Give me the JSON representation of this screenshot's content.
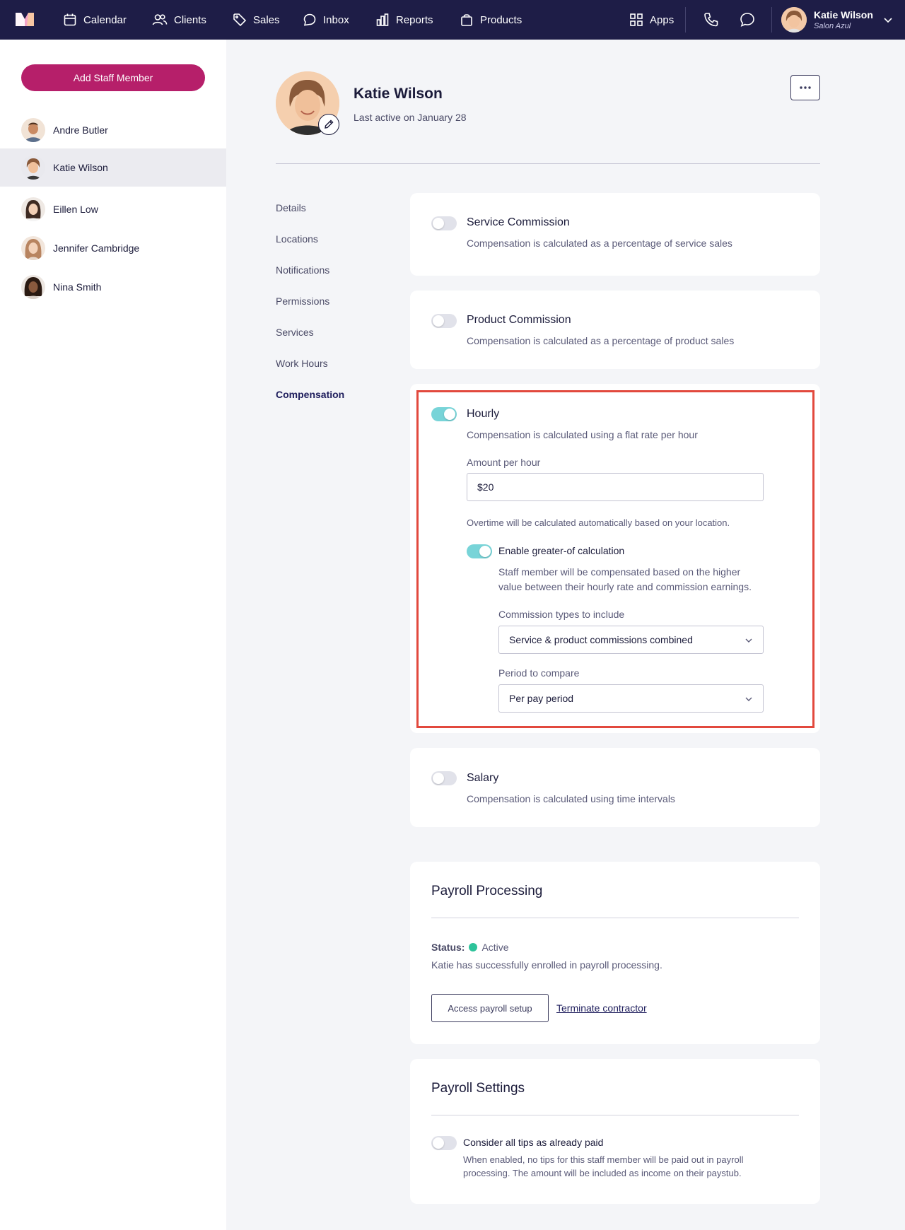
{
  "nav": {
    "items": [
      {
        "label": "Calendar",
        "icon": "calendar-icon"
      },
      {
        "label": "Clients",
        "icon": "clients-icon"
      },
      {
        "label": "Sales",
        "icon": "tag-icon"
      },
      {
        "label": "Inbox",
        "icon": "inbox-icon"
      },
      {
        "label": "Reports",
        "icon": "bar-chart-icon"
      },
      {
        "label": "Products",
        "icon": "shopping-bag-icon"
      }
    ],
    "apps_label": "Apps",
    "user": {
      "name": "Katie Wilson",
      "salon": "Salon Azul"
    }
  },
  "sidebar": {
    "add_button": "Add Staff Member",
    "staff": [
      {
        "name": "Andre Butler"
      },
      {
        "name": "Katie Wilson"
      },
      {
        "name": "Eillen Low"
      },
      {
        "name": "Jennifer Cambridge"
      },
      {
        "name": "Nina Smith"
      }
    ]
  },
  "profile": {
    "name": "Katie Wilson",
    "last_active": "Last active on January 28"
  },
  "subnav": [
    "Details",
    "Locations",
    "Notifications",
    "Permissions",
    "Services",
    "Work Hours",
    "Compensation"
  ],
  "compensation": {
    "service": {
      "title": "Service Commission",
      "desc": "Compensation is calculated as a percentage of service sales",
      "enabled": false
    },
    "product": {
      "title": "Product Commission",
      "desc": "Compensation is calculated as a percentage of product sales",
      "enabled": false
    },
    "hourly": {
      "title": "Hourly",
      "desc": "Compensation is calculated using a flat rate per hour",
      "enabled": true,
      "amount_label": "Amount per hour",
      "amount_value": "$20",
      "overtime_note": "Overtime will be calculated automatically based on your location.",
      "greater_of": {
        "title": "Enable greater-of calculation",
        "enabled": true,
        "desc_line1": "Staff member will be compensated based on the higher",
        "desc_line2": "value between their hourly rate and commission earnings.",
        "types_label": "Commission types to include",
        "types_value": "Service & product commissions combined",
        "period_label": "Period to compare",
        "period_value": "Per pay period"
      }
    },
    "salary": {
      "title": "Salary",
      "desc": "Compensation is calculated using time intervals",
      "enabled": false
    }
  },
  "payroll_processing": {
    "title": "Payroll Processing",
    "status_label": "Status:",
    "status_value": "Active",
    "status_color": "#2dc39a",
    "note": "Katie has successfully enrolled in payroll processing.",
    "setup_button": "Access payroll setup",
    "terminate_link": "Terminate contractor"
  },
  "payroll_settings": {
    "title": "Payroll Settings",
    "tips_title": "Consider all tips as already paid",
    "tips_enabled": false,
    "tips_desc_line1": "When enabled, no tips for this staff member will be paid out in payroll",
    "tips_desc_line2": "processing. The amount will be included as income on their paystub."
  },
  "colors": {
    "nav_bg": "#1e1d47",
    "brand": "#b61f6a",
    "toggle_on": "#78d4d8",
    "highlight": "#e2493d"
  }
}
